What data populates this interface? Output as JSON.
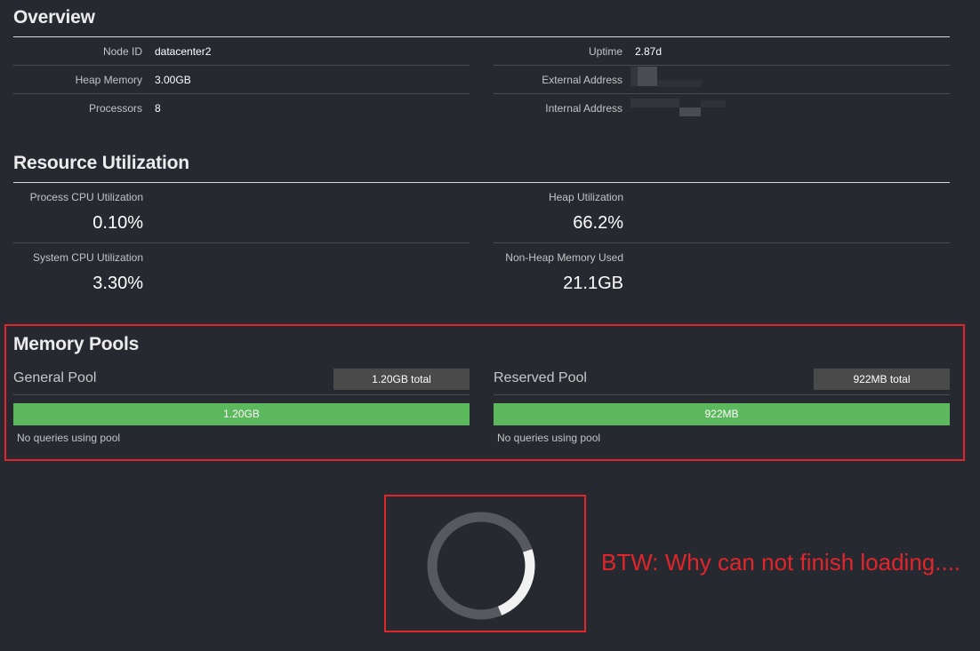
{
  "overview": {
    "title": "Overview",
    "rows_left": [
      {
        "label": "Node ID",
        "value": "datacenter2"
      },
      {
        "label": "Heap Memory",
        "value": "3.00GB"
      },
      {
        "label": "Processors",
        "value": "8"
      }
    ],
    "rows_right": [
      {
        "label": "Uptime",
        "value": "2.87d"
      },
      {
        "label": "External Address",
        "value": ""
      },
      {
        "label": "Internal Address",
        "value": ""
      }
    ]
  },
  "resource": {
    "title": "Resource Utilization",
    "metrics": [
      {
        "label": "Process CPU Utilization",
        "value": "0.10%"
      },
      {
        "label": "Heap Utilization",
        "value": "66.2%"
      },
      {
        "label": "System CPU Utilization",
        "value": "3.30%"
      },
      {
        "label": "Non-Heap Memory Used",
        "value": "21.1GB"
      }
    ]
  },
  "memory_pools": {
    "title": "Memory Pools",
    "pools": [
      {
        "name": "General Pool",
        "total": "1.20GB total",
        "bar_label": "1.20GB",
        "fill": 1.0,
        "note": "No queries using pool"
      },
      {
        "name": "Reserved Pool",
        "total": "922MB total",
        "bar_label": "922MB",
        "fill": 1.0,
        "note": "No queries using pool"
      }
    ]
  },
  "loading": {
    "icon": "spinner-icon"
  },
  "annotation": {
    "text": "BTW: Why can not finish loading....",
    "color": "#e0252b"
  },
  "colors": {
    "background": "#272930",
    "pool_bar": "#5cb85c",
    "highlight": "#e0252b"
  }
}
